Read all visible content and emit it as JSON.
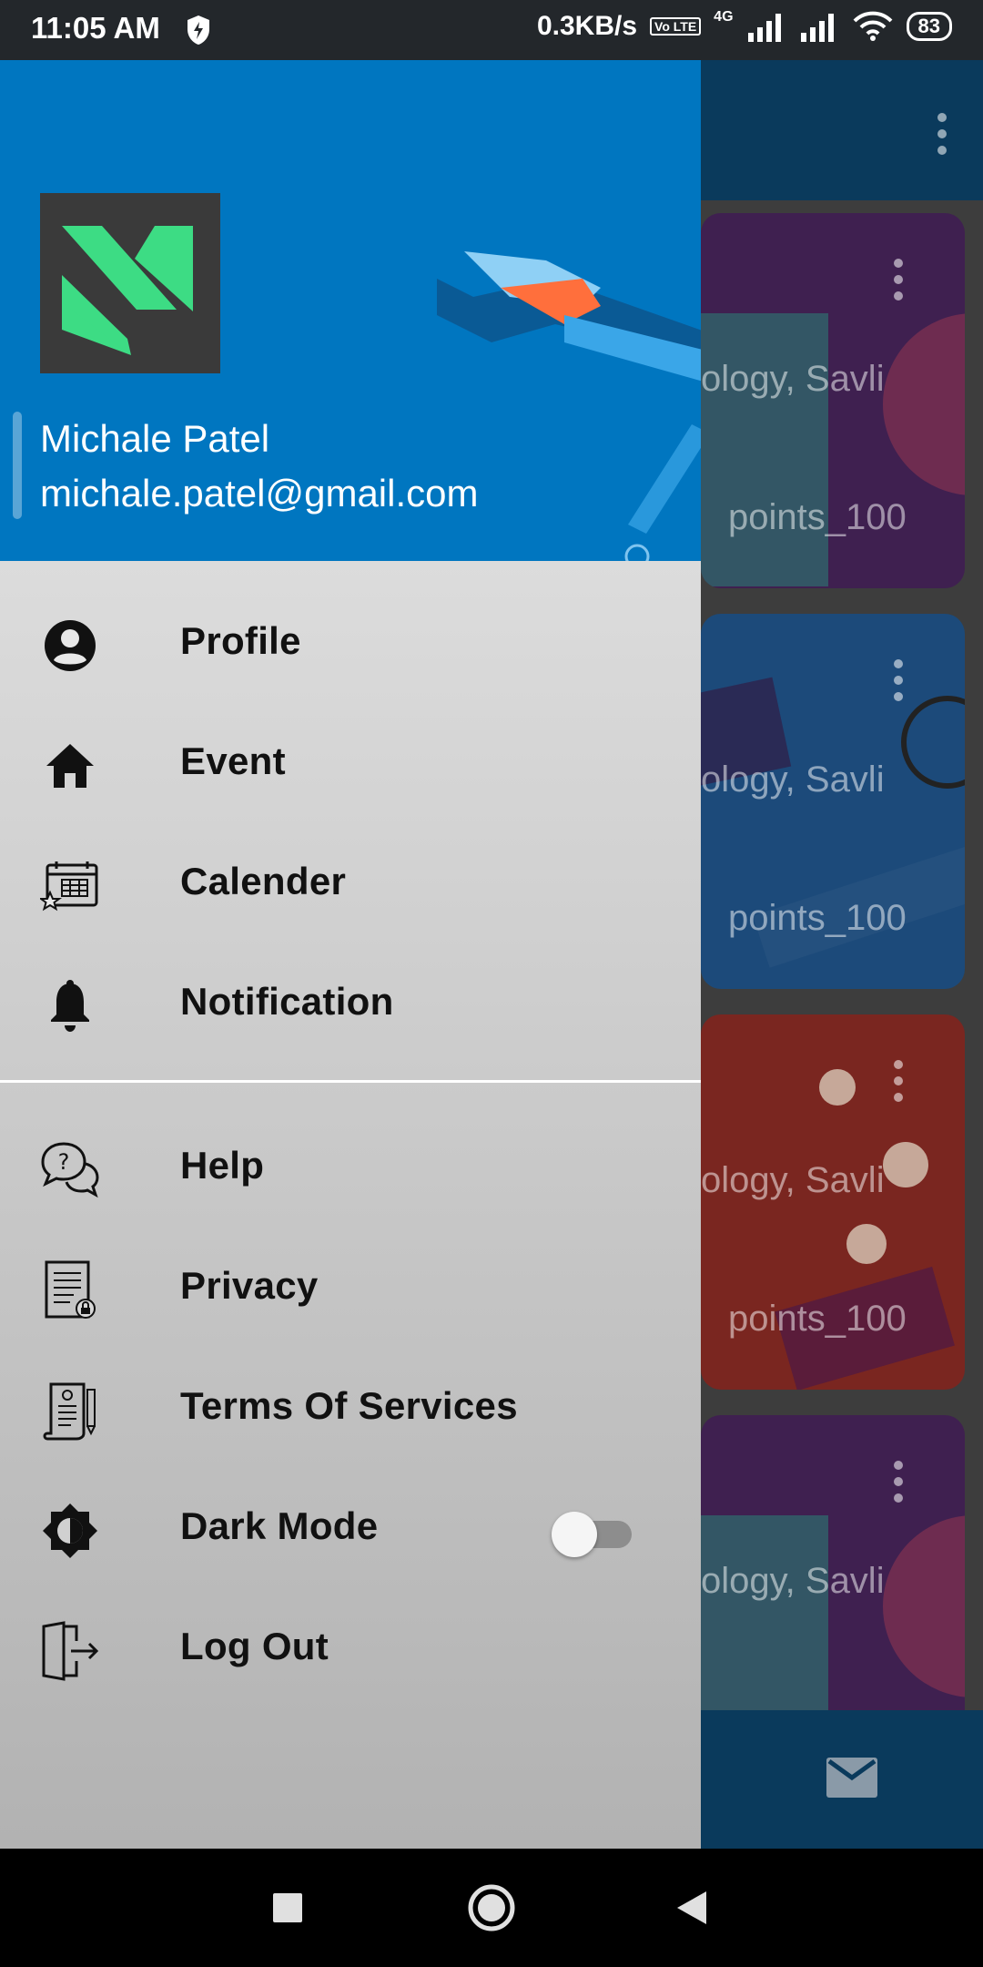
{
  "status_bar": {
    "time": "11:05 AM",
    "network_speed": "0.3KB/s",
    "network_type": "4G",
    "volte": "Vo LTE",
    "battery": "83"
  },
  "background_app": {
    "cards": [
      {
        "text_top": "ology, Savli",
        "text_bottom": "points_100"
      },
      {
        "text_top": "ology, Savli",
        "text_bottom": "points_100"
      },
      {
        "text_top": "ology, Savli",
        "text_bottom": "points_100"
      },
      {
        "text_top": "ology, Savli",
        "text_bottom": ""
      }
    ]
  },
  "drawer": {
    "user": {
      "name": "Michale Patel",
      "email": "michale.patel@gmail.com"
    },
    "menu_primary": [
      {
        "label": "Profile",
        "icon": "account-circle-icon"
      },
      {
        "label": "Event",
        "icon": "home-icon"
      },
      {
        "label": "Calender",
        "icon": "calendar-icon"
      },
      {
        "label": "Notification",
        "icon": "bell-icon"
      }
    ],
    "menu_secondary": [
      {
        "label": "Help",
        "icon": "help-chat-icon"
      },
      {
        "label": "Privacy",
        "icon": "privacy-document-icon"
      },
      {
        "label": "Terms Of Services",
        "icon": "terms-scroll-icon"
      },
      {
        "label": "Dark Mode",
        "icon": "brightness-icon",
        "toggle": false
      },
      {
        "label": "Log Out",
        "icon": "logout-icon"
      }
    ]
  },
  "colors": {
    "header_blue": "#0076c0",
    "logo_green": "#3ddc84",
    "status_bar": "#23272b"
  }
}
